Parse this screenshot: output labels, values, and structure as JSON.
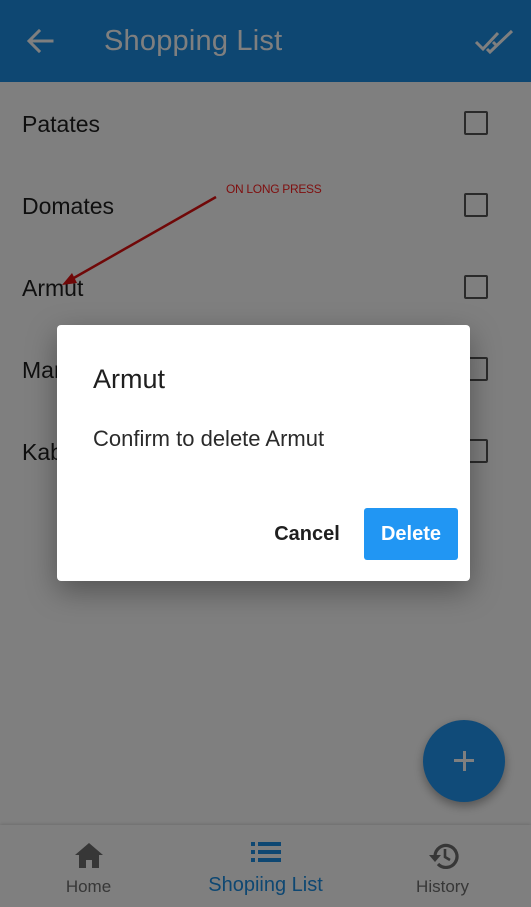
{
  "app_bar": {
    "title": "Shopping List",
    "back_icon": "arrow-back-icon",
    "action_icon": "done-all-icon"
  },
  "list": {
    "items": [
      {
        "label": "Patates",
        "checked": false
      },
      {
        "label": "Domates",
        "checked": false
      },
      {
        "label": "Armut",
        "checked": false
      },
      {
        "label": "Mar",
        "checked": false
      },
      {
        "label": "Kab",
        "checked": false
      }
    ]
  },
  "annotation": {
    "text": "ON LONG PRESS",
    "color": "#ff2020"
  },
  "dialog": {
    "title": "Armut",
    "message": "Confirm to delete Armut",
    "cancel_label": "Cancel",
    "delete_label": "Delete"
  },
  "fab": {
    "icon": "plus-icon"
  },
  "bottom_nav": {
    "items": [
      {
        "label": "Home",
        "icon": "home-icon",
        "active": false
      },
      {
        "label": "Shopiing List",
        "icon": "list-icon",
        "active": true
      },
      {
        "label": "History",
        "icon": "history-icon",
        "active": false
      }
    ]
  },
  "colors": {
    "primary": "#1c8fe4",
    "accent": "#2196f3",
    "scrim": "rgba(0,0,0,0.5)"
  }
}
